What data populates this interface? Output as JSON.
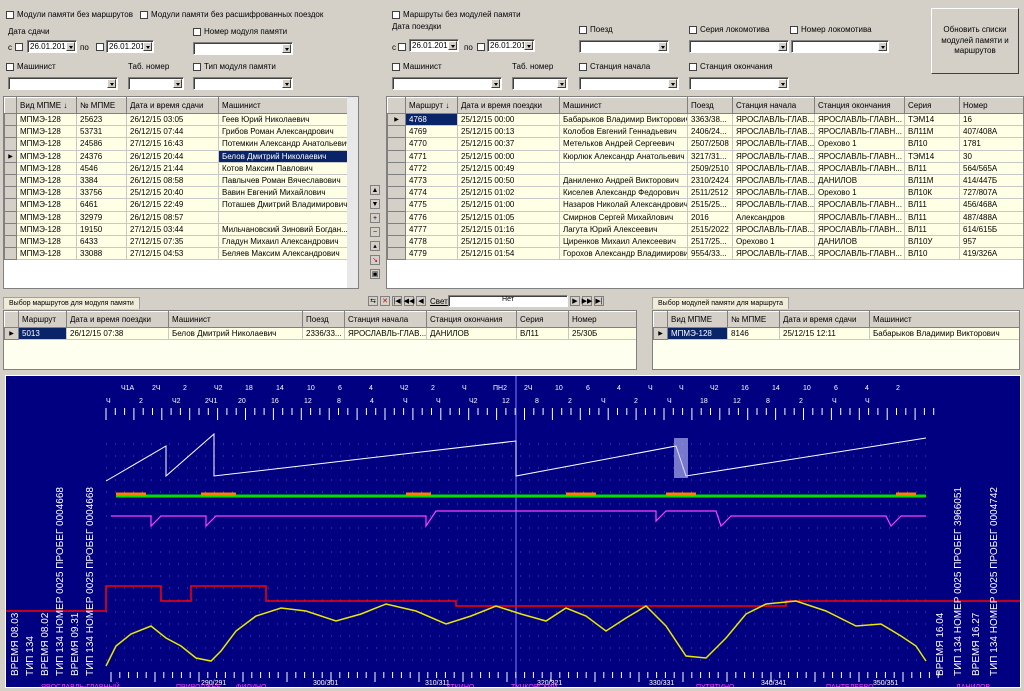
{
  "left_filters": {
    "cb_no_routes": "Модули памяти без маршрутов",
    "cb_no_decoded": "Модули памяти без расшифрованных поездок",
    "date_label": "Дата сдачи",
    "from": "с",
    "to": "по",
    "date_from": "26.01.2016",
    "date_to": "26.01.2016",
    "module_number_label": "Номер модуля памяти",
    "driver_label": "Машинист",
    "tab_label": "Таб. номер",
    "module_type_label": "Тип модуля памяти"
  },
  "right_filters": {
    "cb_routes_no_modules": "Маршруты без модулей памяти",
    "trip_date_label": "Дата поездки",
    "from": "с",
    "to": "по",
    "date_from": "26.01.2016",
    "date_to": "26.01.2016",
    "train_label": "Поезд",
    "loco_series_label": "Серия локомотива",
    "loco_number_label": "Номер локомотива",
    "driver_label": "Машинист",
    "tab_label": "Таб. номер",
    "start_station_label": "Станция начала",
    "end_station_label": "Станция окончания",
    "refresh_button": "Обновить списки модулей памяти и маршрутов"
  },
  "modules_table": {
    "headers": [
      "Вид МПМЕ ↓",
      "№ МПМЕ",
      "Дата и время сдачи",
      "Машинист"
    ],
    "rows": [
      [
        "МПМЭ-128",
        "25623",
        "26/12/15 03:05",
        "Геев Юрий Николаевич"
      ],
      [
        "МПМЭ-128",
        "53731",
        "26/12/15 07:44",
        "Грибов Роман Александрович"
      ],
      [
        "МПМЭ-128",
        "24586",
        "27/12/15 16:43",
        "Потемкин Александр Анатольевич"
      ],
      [
        "МПМЭ-128",
        "24376",
        "26/12/15 20:44",
        "Белов Дмитрий Николаевич"
      ],
      [
        "МПМЭ-128",
        "4546",
        "26/12/15 21:44",
        "Котов Максим Павлович"
      ],
      [
        "МПМЭ-128",
        "3384",
        "26/12/15 08:58",
        "Павлычев Роман Вячеславович"
      ],
      [
        "МПМЭ-128",
        "33756",
        "25/12/15 20:40",
        "Вавин Евгений Михайлович"
      ],
      [
        "МПМЭ-128",
        "6461",
        "26/12/15 22:49",
        "Поташев Дмитрий Владимирович"
      ],
      [
        "МПМЭ-128",
        "32979",
        "26/12/15 08:57",
        ""
      ],
      [
        "МПМЭ-128",
        "19150",
        "27/12/15 03:44",
        "Мильчановский Зиновий Богдан..."
      ],
      [
        "МПМЭ-128",
        "6433",
        "27/12/15 07:35",
        "Гладун Михаил Александрович"
      ],
      [
        "МПМЭ-128",
        "33088",
        "27/12/15 04:53",
        "Беляев Максим Александрович"
      ]
    ],
    "selected_row": 3
  },
  "routes_table": {
    "headers": [
      "Маршрут ↓",
      "Дата и время поездки",
      "Машинист",
      "Поезд",
      "Станция начала",
      "Станция окончания",
      "Серия",
      "Номер"
    ],
    "rows": [
      [
        "4768",
        "25/12/15 00:00",
        "Бабарыков Владимир Викторович",
        "3363/38...",
        "ЯРОСЛАВЛЬ-ГЛАВ...",
        "ЯРОСЛАВЛЬ-ГЛАВН...",
        "ТЭМ14",
        "16"
      ],
      [
        "4769",
        "25/12/15 00:13",
        "Колобов Евгений Геннадьевич",
        "2406/24...",
        "ЯРОСЛАВЛЬ-ГЛАВ...",
        "ЯРОСЛАВЛЬ-ГЛАВН...",
        "ВЛ11М",
        "407/408А"
      ],
      [
        "4770",
        "25/12/15 00:37",
        "Метельков Андрей Сергеевич",
        "2507/2508",
        "ЯРОСЛАВЛЬ-ГЛАВ...",
        "Орехово 1",
        "ВЛ10",
        "1781"
      ],
      [
        "4771",
        "25/12/15 00:00",
        "Кюрлюк Александр Анатольевич",
        "3217/31...",
        "ЯРОСЛАВЛЬ-ГЛАВ...",
        "ЯРОСЛАВЛЬ-ГЛАВН...",
        "ТЭМ14",
        "30"
      ],
      [
        "4772",
        "25/12/15 00:49",
        "",
        "2509/2510",
        "ЯРОСЛАВЛЬ-ГЛАВ...",
        "ЯРОСЛАВЛЬ-ГЛАВН...",
        "ВЛ11",
        "564/565А"
      ],
      [
        "4773",
        "25/12/15 00:50",
        "Даниленко Андрей Викторович",
        "2310/2424",
        "ЯРОСЛАВЛЬ-ГЛАВ...",
        "ДАНИЛОВ",
        "ВЛ11М",
        "414/447Б"
      ],
      [
        "4774",
        "25/12/15 01:02",
        "Киселев Александр Федорович",
        "2511/2512",
        "ЯРОСЛАВЛЬ-ГЛАВ...",
        "Орехово 1",
        "ВЛ10К",
        "727/807А"
      ],
      [
        "4775",
        "25/12/15 01:00",
        "Назаров Николай Александрович",
        "2515/25...",
        "ЯРОСЛАВЛЬ-ГЛАВ...",
        "ЯРОСЛАВЛЬ-ГЛАВН...",
        "ВЛ11",
        "456/468А"
      ],
      [
        "4776",
        "25/12/15 01:05",
        "Смирнов Сергей Михайлович",
        "2016",
        "Александров",
        "ЯРОСЛАВЛЬ-ГЛАВН...",
        "ВЛ11",
        "487/488А"
      ],
      [
        "4777",
        "25/12/15 01:16",
        "Лагута Юрий Алексеевич",
        "2515/2022",
        "ЯРОСЛАВЛЬ-ГЛАВ...",
        "ЯРОСЛАВЛЬ-ГЛАВН...",
        "ВЛ11",
        "614/615Б"
      ],
      [
        "4778",
        "25/12/15 01:50",
        "Циренков Михаил Алексеевич",
        "2517/25...",
        "Орехово 1",
        "ДАНИЛОВ",
        "ВЛ10У",
        "957"
      ],
      [
        "4779",
        "25/12/15 01:54",
        "Горохов Александр Владимирович",
        "9554/33...",
        "ЯРОСЛАВЛЬ-ГЛАВ...",
        "ЯРОСЛАВЛЬ-ГЛАВН...",
        "ВЛ10",
        "419/326А"
      ]
    ],
    "selected_row": 0
  },
  "navigator": {
    "search_label": "Свет",
    "search_value": "Нет"
  },
  "route_select": {
    "tab": "Выбор маршрутов для модуля памяти",
    "headers": [
      "Маршрут",
      "Дата и время поездки",
      "Машинист",
      "Поезд",
      "Станция начала",
      "Станция окончания",
      "Серия",
      "Номер"
    ],
    "row": [
      "5013",
      "26/12/15 07:38",
      "Белов Дмитрий Николаевич",
      "2336/33...",
      "ЯРОСЛАВЛЬ-ГЛАВ...",
      "ДАНИЛОВ",
      "ВЛ11",
      "25/30Б"
    ]
  },
  "module_select": {
    "tab": "Выбор модулей памяти для маршрута",
    "headers": [
      "Вид МПМЕ",
      "№ МПМЕ",
      "Дата и время сдачи",
      "Машинист"
    ],
    "row": [
      "МПМЭ-128",
      "8146",
      "25/12/15 12:11",
      "Бабарыков Владимир Викторович"
    ]
  },
  "chart": {
    "top_marks": [
      "Ч1А",
      "2Ч",
      "2",
      "Ч2",
      "18",
      "14",
      "10",
      "6",
      "4",
      "Ч2",
      "2",
      "Ч",
      "ПН2",
      "2Ч",
      "10",
      "6",
      "4",
      "Ч",
      "Ч",
      "Ч2",
      "16",
      "14",
      "10",
      "6",
      "4",
      "2"
    ],
    "top_marks2": [
      "Ч",
      "2",
      "Ч2",
      "2Ч1",
      "20",
      "16",
      "12",
      "8",
      "4",
      "Ч",
      "Ч",
      "Ч2",
      "12",
      "8",
      "2",
      "Ч",
      "2",
      "Ч",
      "18",
      "12",
      "8",
      "2",
      "Ч",
      "Ч"
    ],
    "km_marks": [
      "290/291",
      "300/301",
      "310/311",
      "320/321",
      "330/331",
      "340/341",
      "350/351"
    ],
    "stations": [
      "ЯРОСЛАВЛЬ-ГЛАВНЫЙ",
      "ПРИВОЛЖЬЕ",
      "ФИЛИНО",
      "УТКИНО",
      "ТУЧКОВСКИЙ",
      "ПУТЯТИНО",
      "ПАНТЕЛЕЕВО",
      "ДАНИЛОВ"
    ],
    "left_block": [
      "ВРЕМЯ 08.03",
      "ТИП 134",
      "ВРЕМЯ 08.02",
      "ТИП 134 НОМЕР 0025 ПРОБЕГ 0004668",
      "ВРЕМЯ 09.31",
      "ТИП 134 НОМЕР 0025 ПРОБЕГ 0004668"
    ],
    "right_block": [
      "ВРЕМЯ 16.04",
      "ТИП 134 НОМЕР 0025 ПРОБЕГ 3966051",
      "ВРЕМЯ 16.27",
      "ТИП 134 НОМЕР 0025 ПРОБЕГ 0004742"
    ],
    "colors": {
      "bg": "#000080",
      "green": "#00e000",
      "orange": "#ff8000",
      "magenta": "#ff40ff",
      "yellow": "#e8e800",
      "red": "#ff0000",
      "white": "#ffffff"
    }
  }
}
